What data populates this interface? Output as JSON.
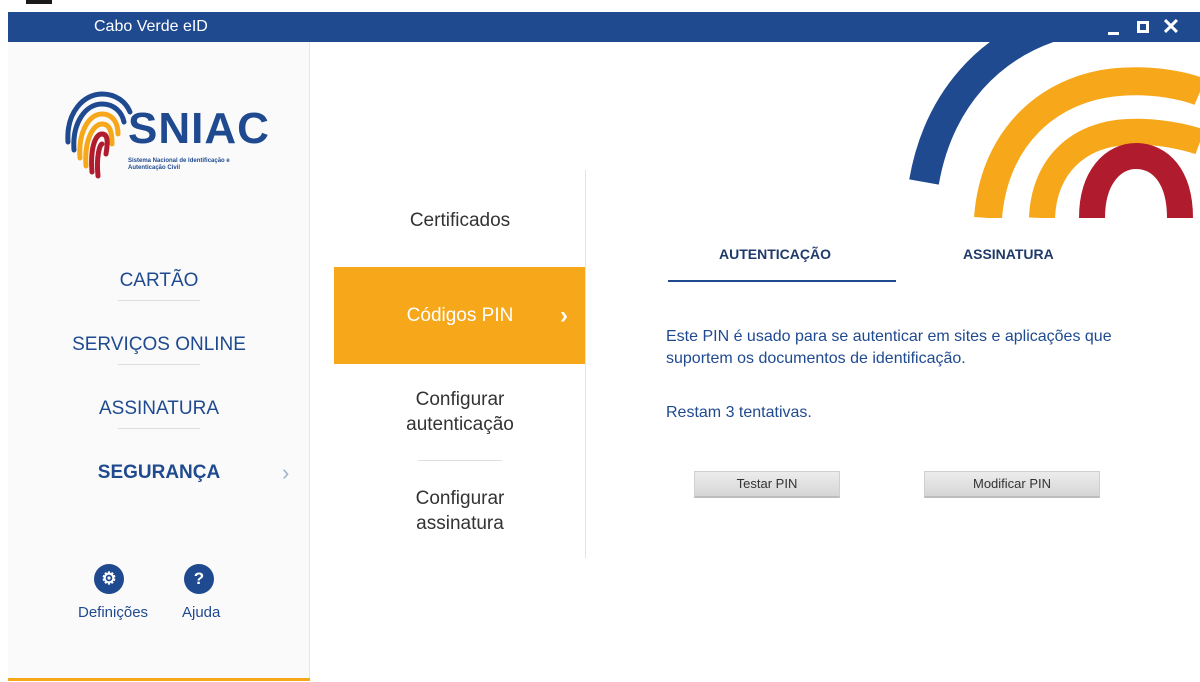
{
  "window": {
    "title": "Cabo Verde eID"
  },
  "colors": {
    "brand_blue": "#1f4a8f",
    "accent_orange": "#f6a71a",
    "accent_red": "#b01c2e"
  },
  "logo": {
    "name": "SNIAC",
    "subtitle": "Sistema Nacional de Identificação e Autenticação Civil"
  },
  "sidebar": {
    "items": [
      {
        "label": "CARTÃO"
      },
      {
        "label": "SERVIÇOS ONLINE"
      },
      {
        "label": "ASSINATURA"
      },
      {
        "label": "SEGURANÇA",
        "active": true
      }
    ],
    "settings_label": "Definições",
    "help_label": "Ajuda",
    "settings_icon": "gear-icon",
    "help_icon": "question-icon"
  },
  "menu": {
    "items": [
      {
        "label": "Certificados"
      },
      {
        "label": "Códigos PIN",
        "active": true
      },
      {
        "label": "Configurar autenticação"
      },
      {
        "label": "Configurar assinatura"
      }
    ]
  },
  "tabs": [
    {
      "label": "AUTENTICAÇÃO",
      "active": true
    },
    {
      "label": "ASSINATURA"
    }
  ],
  "content": {
    "description": "Este PIN é usado para se autenticar em sites e aplicações que suportem os documentos de identificação.",
    "attempts": "Restam 3 tentativas."
  },
  "buttons": {
    "test_pin": "Testar PIN",
    "modify_pin": "Modificar PIN"
  }
}
